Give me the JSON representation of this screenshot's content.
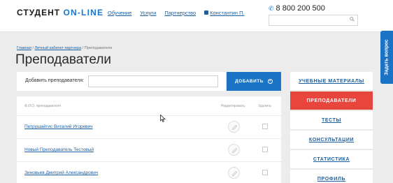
{
  "header": {
    "logo_left": "СТУДЕНТ",
    "logo_right": "ON-LINE",
    "nav": [
      "Обучение",
      "Услуги",
      "Партнерство"
    ],
    "user": "Константин П.",
    "phone": "8 800 200 500",
    "search_placeholder": ""
  },
  "breadcrumb": {
    "home": "Главная",
    "cabinet": "Личный кабинет партнера",
    "current": "Преподаватели",
    "sep": " / "
  },
  "page_title": "Преподаватели",
  "add_form": {
    "label": "Добавить преподавателя:",
    "value": "",
    "button": "ДОБАВИТЬ"
  },
  "table": {
    "headers": [
      "Ф.И.О. преподавателя",
      "Редактировать",
      "Удалить"
    ],
    "rows": [
      {
        "name": "Петрушайтис Виталий Игоревич"
      },
      {
        "name": "Новый Преподаватель Тестовый"
      },
      {
        "name": "Зиновьев Дмитрий Александрович"
      }
    ]
  },
  "side_menu": [
    {
      "label": "УЧЕБНЫЕ МАТЕРИАЛЫ",
      "active": false
    },
    {
      "label": "ПРЕПОДАВАТЕЛИ",
      "active": true
    },
    {
      "label": "ТЕСТЫ",
      "active": false
    },
    {
      "label": "КОНСУЛЬТАЦИИ",
      "active": false
    },
    {
      "label": "СТАТИСТИКА",
      "active": false
    },
    {
      "label": "ПРОФИЛЬ",
      "active": false
    }
  ],
  "ask_tab": "Задать вопрос",
  "colors": {
    "brand": "#1976c9",
    "primary_button": "#1a73c4",
    "active_menu": "#e8453c",
    "link": "#1b5fa3"
  },
  "icons": {
    "phone": "phone-icon",
    "search": "search-icon",
    "lock": "lock-icon",
    "add": "plus-circle-icon",
    "edit": "pencil-icon",
    "delete": "checkbox"
  }
}
